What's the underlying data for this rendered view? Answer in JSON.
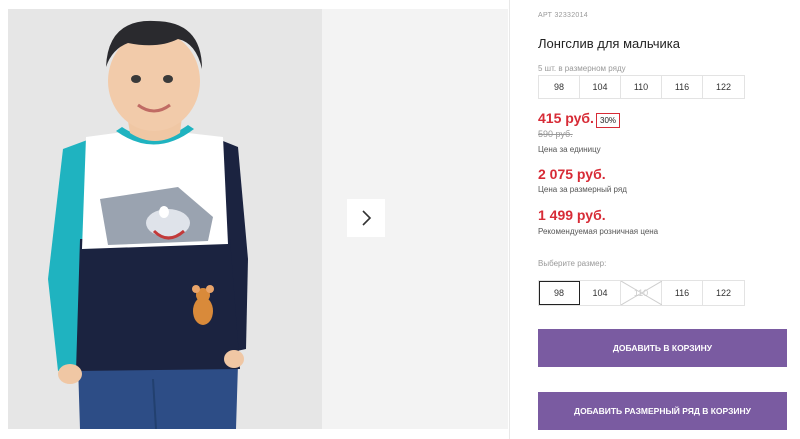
{
  "product": {
    "sku": "АРТ 32332014",
    "title": "Лонгслив для мальчика",
    "pack_label": "5 шт. в размерном ряду",
    "pack_sizes": [
      "98",
      "104",
      "110",
      "116",
      "122"
    ]
  },
  "pricing": {
    "unit_price": "415 руб.",
    "discount": "30%",
    "old_price": "590 руб.",
    "unit_price_note": "Цена за единицу",
    "pack_price": "2 075 руб.",
    "pack_price_note": "Цена за размерный ряд",
    "retail_price": "1 499 руб.",
    "retail_price_note": "Рекомендуемая розничная цена"
  },
  "size_picker": {
    "label": "Выберите размер:",
    "sizes": [
      {
        "value": "98",
        "state": "selected"
      },
      {
        "value": "104",
        "state": "available"
      },
      {
        "value": "110",
        "state": "unavailable"
      },
      {
        "value": "116",
        "state": "available"
      },
      {
        "value": "122",
        "state": "available"
      }
    ]
  },
  "buttons": {
    "add_to_cart": "ДОБАВИТЬ В КОРЗИНУ",
    "add_pack_to_cart": "ДОБАВИТЬ РАЗМЕРНЫЙ РЯД В КОРЗИНУ"
  },
  "icons": {
    "gallery_next": "chevron-right-icon"
  },
  "colors": {
    "price_red": "#d72b36",
    "button_purple": "#7a5ba1",
    "shirt_navy": "#1b2340",
    "shirt_teal": "#1fb3c0"
  }
}
